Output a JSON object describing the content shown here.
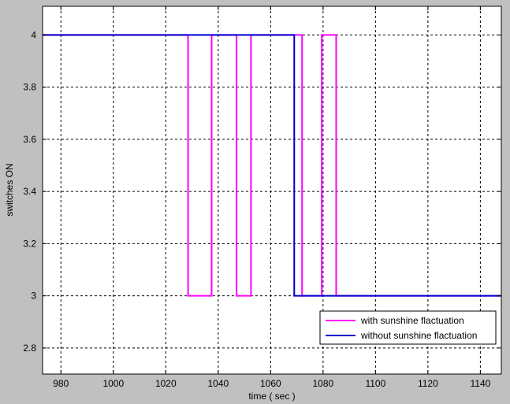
{
  "chart_data": {
    "type": "line",
    "title": "",
    "xlabel": "time ( sec )",
    "ylabel": "switches ON",
    "xlim": [
      973,
      1148
    ],
    "ylim": [
      2.7,
      4.11
    ],
    "xticks": [
      980,
      1000,
      1020,
      1040,
      1060,
      1080,
      1100,
      1120,
      1140
    ],
    "yticks": [
      2.8,
      3,
      3.2,
      3.4,
      3.6,
      3.8,
      4
    ],
    "xtick_labels": [
      "980",
      "1000",
      "1020",
      "1040",
      "1060",
      "1080",
      "1100",
      "1120",
      "1140"
    ],
    "ytick_labels": [
      "2.8",
      "3",
      "3.2",
      "3.4",
      "3.6",
      "3.8",
      "4"
    ],
    "grid": true,
    "legend_position": "bottom-right",
    "colors": {
      "background": "#c0c0c0",
      "axes_face": "#ffffff",
      "grid": "#000000"
    },
    "series": [
      {
        "name": "with sunshine flactuation",
        "color": "#ff00ff",
        "x": [
          973,
          1028.5,
          1028.5,
          1037.5,
          1037.5,
          1047,
          1047,
          1052.5,
          1052.5,
          1072,
          1072,
          1079.5,
          1079.5,
          1085,
          1085,
          1148
        ],
        "y": [
          4,
          4,
          3,
          3,
          4,
          4,
          3,
          3,
          4,
          4,
          3,
          3,
          4,
          4,
          3,
          3
        ]
      },
      {
        "name": "without sunshine flactuation",
        "color": "#0000cc",
        "x": [
          973,
          1069,
          1069,
          1148
        ],
        "y": [
          4,
          4,
          3,
          3
        ]
      }
    ]
  }
}
